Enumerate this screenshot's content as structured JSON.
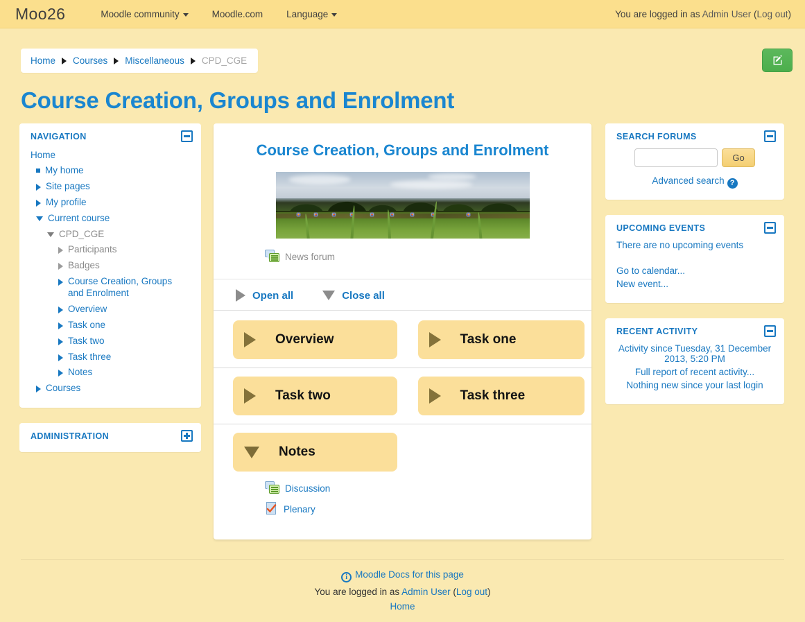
{
  "navbar": {
    "brand": "Moo26",
    "items": [
      {
        "label": "Moodle community",
        "has_caret": true
      },
      {
        "label": "Moodle.com",
        "has_caret": false
      },
      {
        "label": "Language",
        "has_caret": true
      }
    ],
    "login_prefix": "You are logged in as ",
    "user_name": "Admin User",
    "logout_open": " (",
    "logout_label": "Log out",
    "logout_close": ")"
  },
  "breadcrumb": {
    "items": [
      "Home",
      "Courses",
      "Miscellaneous"
    ],
    "current": "CPD_CGE"
  },
  "edit_button": {
    "icon": "edit-pencil-icon"
  },
  "page": {
    "title": "Course Creation, Groups and Enrolment"
  },
  "navigation_block": {
    "title": "NAVIGATION",
    "toggle_icon": "minus-icon",
    "root": "Home",
    "items": [
      {
        "label": "My home",
        "indent": 1,
        "marker": "square",
        "dim": false
      },
      {
        "label": "Site pages",
        "indent": 1,
        "marker": "triangle-right",
        "dim": false
      },
      {
        "label": "My profile",
        "indent": 1,
        "marker": "triangle-right",
        "dim": false
      },
      {
        "label": "Current course",
        "indent": 1,
        "marker": "triangle-down",
        "dim": false
      },
      {
        "label": "CPD_CGE",
        "indent": 2,
        "marker": "triangle-down-grey",
        "dim": true
      },
      {
        "label": "Participants",
        "indent": 3,
        "marker": "triangle-right-grey",
        "dim": true
      },
      {
        "label": "Badges",
        "indent": 3,
        "marker": "triangle-right-grey",
        "dim": true
      },
      {
        "label": "Course Creation, Groups and Enrolment",
        "indent": 3,
        "marker": "triangle-right",
        "dim": false
      },
      {
        "label": "Overview",
        "indent": 3,
        "marker": "triangle-right",
        "dim": false
      },
      {
        "label": "Task one",
        "indent": 3,
        "marker": "triangle-right",
        "dim": false
      },
      {
        "label": "Task two",
        "indent": 3,
        "marker": "triangle-right",
        "dim": false
      },
      {
        "label": "Task three",
        "indent": 3,
        "marker": "triangle-right",
        "dim": false
      },
      {
        "label": "Notes",
        "indent": 3,
        "marker": "triangle-right",
        "dim": false
      },
      {
        "label": "Courses",
        "indent": 1,
        "marker": "triangle-right",
        "dim": false
      }
    ]
  },
  "administration_block": {
    "title": "ADMINISTRATION",
    "toggle_icon": "plus-icon"
  },
  "course": {
    "heading": "Course Creation, Groups and Enrolment",
    "image_alt": "archery-field-photo",
    "news_forum": {
      "label": "News forum",
      "icon": "forum-icon"
    },
    "open_all": "Open all",
    "close_all": "Close all",
    "topics": [
      {
        "name": "Overview",
        "state": "collapsed",
        "icon": "triangle-right-icon",
        "activities": []
      },
      {
        "name": "Task one",
        "state": "collapsed",
        "icon": "triangle-right-icon",
        "activities": []
      },
      {
        "name": "Task two",
        "state": "collapsed",
        "icon": "triangle-right-icon",
        "activities": []
      },
      {
        "name": "Task three",
        "state": "collapsed",
        "icon": "triangle-right-icon",
        "activities": []
      },
      {
        "name": "Notes",
        "state": "expanded",
        "icon": "triangle-down-icon",
        "activities": [
          {
            "label": "Discussion",
            "icon": "forum-icon"
          },
          {
            "label": "Plenary",
            "icon": "choice-icon"
          }
        ]
      }
    ]
  },
  "search_forums_block": {
    "title": "SEARCH FORUMS",
    "toggle_icon": "minus-icon",
    "input_value": "",
    "input_placeholder": "",
    "go_label": "Go",
    "advanced_label": "Advanced search",
    "help_icon": "help-icon"
  },
  "upcoming_events_block": {
    "title": "UPCOMING EVENTS",
    "toggle_icon": "minus-icon",
    "empty_text": "There are no upcoming events",
    "links": [
      "Go to calendar...",
      "New event..."
    ]
  },
  "recent_activity_block": {
    "title": "RECENT ACTIVITY",
    "toggle_icon": "minus-icon",
    "since_text": "Activity since Tuesday, 31 December 2013, 5:20 PM",
    "full_report": "Full report of recent activity...",
    "nothing_new": "Nothing new since your last login"
  },
  "footer": {
    "docs_label": "Moodle Docs for this page",
    "docs_icon": "info-icon",
    "login_prefix": "You are logged in as ",
    "user_name": "Admin User",
    "logout_open": " (",
    "logout_label": "Log out",
    "logout_close": ")",
    "home_label": "Home"
  },
  "colors": {
    "page_bg": "#fae9b1",
    "navbar_bg": "#fbdf8d",
    "link_blue": "#1878c1",
    "heading_blue": "#1a86d0",
    "tile_tan": "#fbdf9a",
    "tile_triangle": "#84723a",
    "edit_green": "#5cb85c"
  }
}
